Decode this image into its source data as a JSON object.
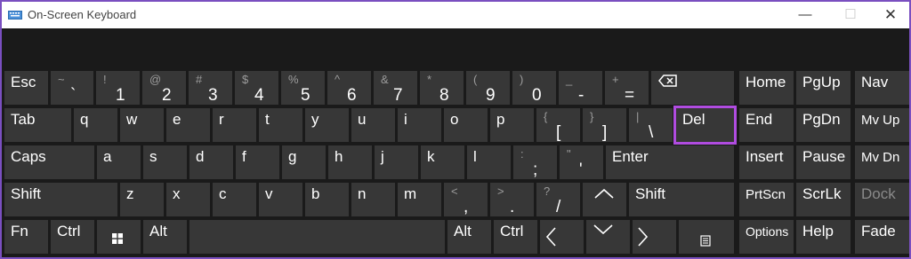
{
  "window": {
    "title": "On-Screen Keyboard",
    "minimize": "—",
    "maximize": "☐",
    "close": "✕"
  },
  "keys": {
    "esc": "Esc",
    "grave": {
      "top": "~",
      "bottom": "`"
    },
    "n1": {
      "top": "!",
      "bottom": "1"
    },
    "n2": {
      "top": "@",
      "bottom": "2"
    },
    "n3": {
      "top": "#",
      "bottom": "3"
    },
    "n4": {
      "top": "$",
      "bottom": "4"
    },
    "n5": {
      "top": "%",
      "bottom": "5"
    },
    "n6": {
      "top": "^",
      "bottom": "6"
    },
    "n7": {
      "top": "&",
      "bottom": "7"
    },
    "n8": {
      "top": "*",
      "bottom": "8"
    },
    "n9": {
      "top": "(",
      "bottom": "9"
    },
    "n0": {
      "top": ")",
      "bottom": "0"
    },
    "minus": {
      "top": "_",
      "bottom": "-"
    },
    "equals": {
      "top": "+",
      "bottom": "="
    },
    "tab": "Tab",
    "q": "q",
    "w": "w",
    "e": "e",
    "r": "r",
    "t": "t",
    "y": "y",
    "u": "u",
    "i": "i",
    "o": "o",
    "p": "p",
    "lbracket": {
      "top": "{",
      "bottom": "["
    },
    "rbracket": {
      "top": "}",
      "bottom": "]"
    },
    "backslash": {
      "top": "|",
      "bottom": "\\"
    },
    "del": "Del",
    "caps": "Caps",
    "a": "a",
    "s": "s",
    "d": "d",
    "f": "f",
    "g": "g",
    "h": "h",
    "j": "j",
    "k": "k",
    "l": "l",
    "semicolon": {
      "top": ":",
      "bottom": ";"
    },
    "quote": {
      "top": "\"",
      "bottom": "'"
    },
    "enter": "Enter",
    "shift_left": "Shift",
    "z": "z",
    "x": "x",
    "c": "c",
    "v": "v",
    "b": "b",
    "n": "n",
    "m": "m",
    "comma": {
      "top": "<",
      "bottom": ","
    },
    "period": {
      "top": ">",
      "bottom": "."
    },
    "slash": {
      "top": "?",
      "bottom": "/"
    },
    "shift_right": "Shift",
    "fn": "Fn",
    "ctrl_left": "Ctrl",
    "alt_left": "Alt",
    "alt_right": "Alt",
    "ctrl_right": "Ctrl",
    "home": "Home",
    "pgup": "PgUp",
    "nav": "Nav",
    "end": "End",
    "pgdn": "PgDn",
    "mvup": "Mv Up",
    "insert": "Insert",
    "pause": "Pause",
    "mvdn": "Mv Dn",
    "prtscn": "PrtScn",
    "scrlk": "ScrLk",
    "dock": "Dock",
    "options": "Options",
    "help": "Help",
    "fade": "Fade"
  }
}
